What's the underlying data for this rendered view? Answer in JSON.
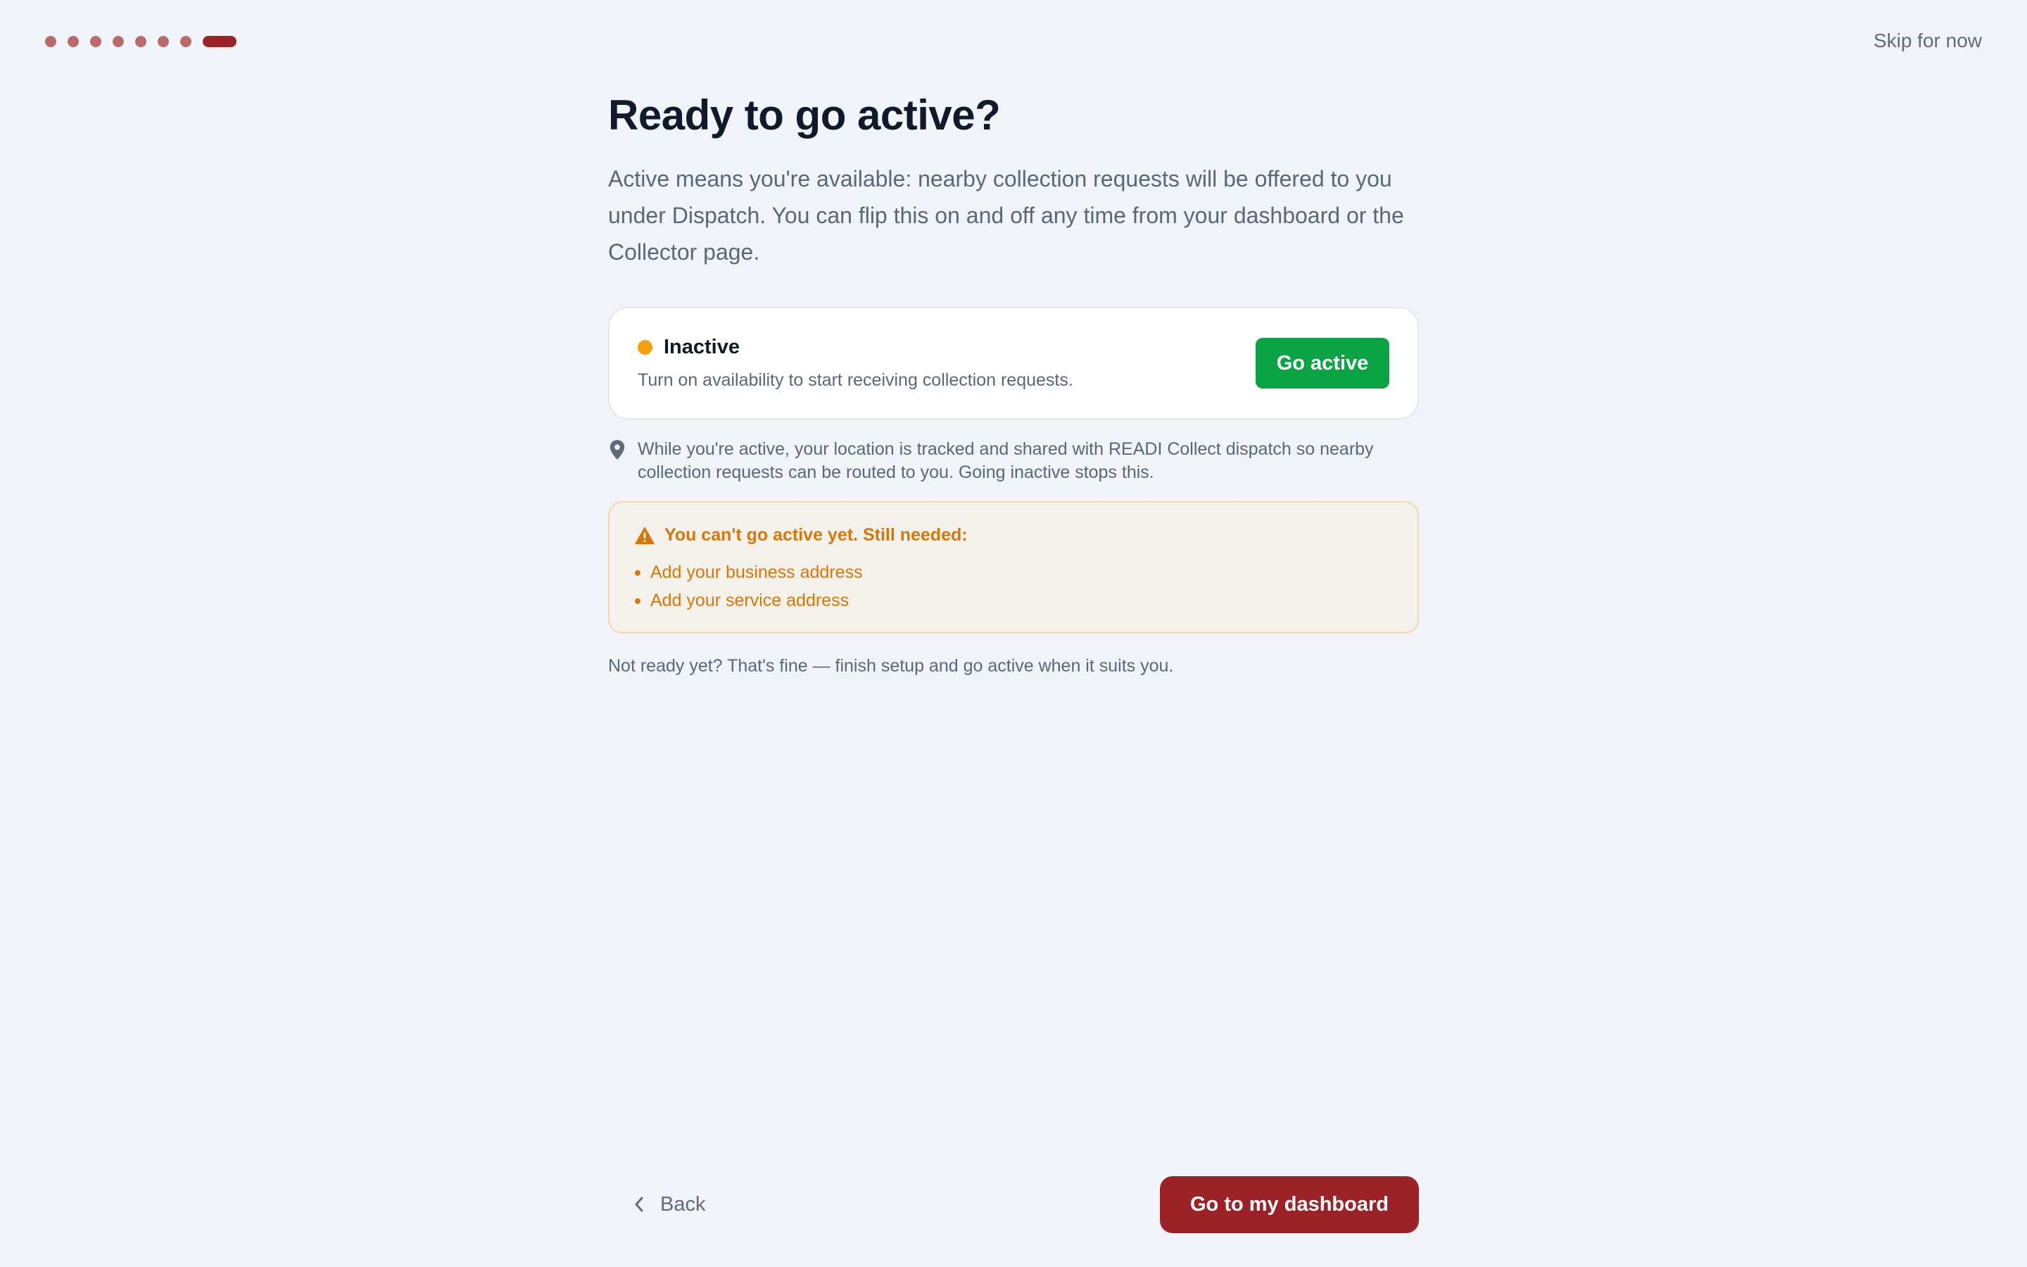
{
  "progress": {
    "total_steps": 8,
    "current_step": 8,
    "completed_color": "#b96a6d",
    "current_color": "#9b2227"
  },
  "header": {
    "skip_label": "Skip for now"
  },
  "main": {
    "title": "Ready to go active?",
    "lead": "Active means you're available: nearby collection requests will be offered to you under Dispatch. You can flip this on and off any time from your dashboard or the Collector page.",
    "status_card": {
      "status": "Inactive",
      "status_color": "#f5a00d",
      "description": "Turn on availability to start receiving collection requests.",
      "action_label": "Go active",
      "action_color": "#0aa444"
    },
    "location_note": {
      "icon": "map-pin-icon",
      "text": "While you're active, your location is tracked and shared with READI Collect dispatch so nearby collection requests can be routed to you. Going inactive stops this."
    },
    "warning": {
      "icon": "warning-triangle-icon",
      "title": "You can't go active yet. Still needed:",
      "items": [
        "Add your business address",
        "Add your service address"
      ],
      "color": "#d97706"
    },
    "footer_note": "Not ready yet? That's fine — finish setup and go active when it suits you."
  },
  "nav": {
    "back_label": "Back",
    "primary_label": "Go to my dashboard",
    "primary_color": "#9b2227"
  }
}
